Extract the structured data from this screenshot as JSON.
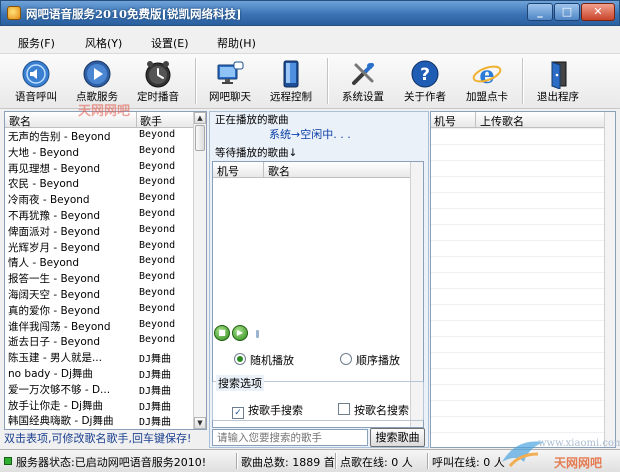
{
  "window": {
    "title": "网吧语音服务2010免费版[锐凯网络科技]",
    "min_label": "_",
    "max_label": "□",
    "close_label": "✕"
  },
  "menu": [
    {
      "label": "服务(F)"
    },
    {
      "label": "风格(Y)"
    },
    {
      "label": "设置(E)"
    },
    {
      "label": "帮助(H)"
    }
  ],
  "toolbar": [
    {
      "label": "语音呼叫",
      "icon": "speaker-icon"
    },
    {
      "label": "点歌服务",
      "icon": "play-icon"
    },
    {
      "label": "定时播音",
      "icon": "clock-icon"
    },
    {
      "label": "网吧聊天",
      "icon": "chat-icon"
    },
    {
      "label": "远程控制",
      "icon": "remote-icon"
    },
    {
      "label": "系统设置",
      "icon": "tools-icon"
    },
    {
      "label": "关于作者",
      "icon": "help-icon"
    },
    {
      "label": "加盟点卡",
      "icon": "ie-icon"
    },
    {
      "label": "退出程序",
      "icon": "exit-icon"
    }
  ],
  "watermark": "天网网吧",
  "song_list": {
    "columns": [
      "歌名",
      "歌手"
    ],
    "rows": [
      {
        "name": "无声的告别 - Beyond",
        "artist": "Beyond"
      },
      {
        "name": "大地 - Beyond",
        "artist": "Beyond"
      },
      {
        "name": "再见理想 - Beyond",
        "artist": "Beyond"
      },
      {
        "name": "农民 - Beyond",
        "artist": "Beyond"
      },
      {
        "name": "冷雨夜 - Beyond",
        "artist": "Beyond"
      },
      {
        "name": "不再犹豫 - Beyond",
        "artist": "Beyond"
      },
      {
        "name": "俾面派对 - Beyond",
        "artist": "Beyond"
      },
      {
        "name": "光辉岁月 - Beyond",
        "artist": "Beyond"
      },
      {
        "name": "情人 - Beyond",
        "artist": "Beyond"
      },
      {
        "name": "报答一生 - Beyond",
        "artist": "Beyond"
      },
      {
        "name": "海阔天空 - Beyond",
        "artist": "Beyond"
      },
      {
        "name": "真的爱你 - Beyond",
        "artist": "Beyond"
      },
      {
        "name": "谁伴我闯荡 - Beyond",
        "artist": "Beyond"
      },
      {
        "name": "逝去日子 - Beyond",
        "artist": "Beyond"
      },
      {
        "name": "陈玉建 - 男人就是...",
        "artist": "DJ舞曲"
      },
      {
        "name": "no bady - Dj舞曲",
        "artist": "DJ舞曲"
      },
      {
        "name": "爱一万次够不够 - D...",
        "artist": "DJ舞曲"
      },
      {
        "name": "放手让你走 - Dj舞曲",
        "artist": "DJ舞曲"
      },
      {
        "name": "韩国经典嗨歌 - Dj舞曲",
        "artist": "DJ舞曲"
      }
    ]
  },
  "now_playing": {
    "label": "正在播放的歌曲",
    "status": "系统→空闲中. . ."
  },
  "queue": {
    "label": "等待播放的歌曲↓",
    "columns": [
      "机号",
      "歌名"
    ]
  },
  "player": {
    "stop_symbol": "■",
    "play_symbol": "▶"
  },
  "play_mode": {
    "random": "随机播放",
    "sequence": "顺序播放",
    "selected": "random"
  },
  "search": {
    "group_label": "搜索选项",
    "by_artist": "按歌手搜索",
    "by_artist_checked": true,
    "by_title": "按歌名搜索",
    "by_title_checked": false,
    "placeholder": "请输入您要搜索的歌手",
    "button_label": "搜索歌曲",
    "check_mark": "✓"
  },
  "upload_list": {
    "columns": [
      "机号",
      "上传歌名"
    ]
  },
  "hint": "双击表项,可修改歌名歌手,回车键保存!",
  "status_bar": {
    "server_status": "服务器状态:已启动网吧语音服务2010!",
    "song_total": "歌曲总数: 1889 首",
    "online_songs": "点歌在线: 0 人",
    "online_calls": "呼叫在线: 0 人"
  },
  "corner_logo": {
    "text1": "www.xiaomi.com",
    "text2": "天网网吧"
  },
  "colors": {
    "title_bar": "#3b73b5",
    "panel_bg": "#eaf1f9",
    "status_blue": "#0a3ea8",
    "radio_green": "#2b8a23"
  }
}
